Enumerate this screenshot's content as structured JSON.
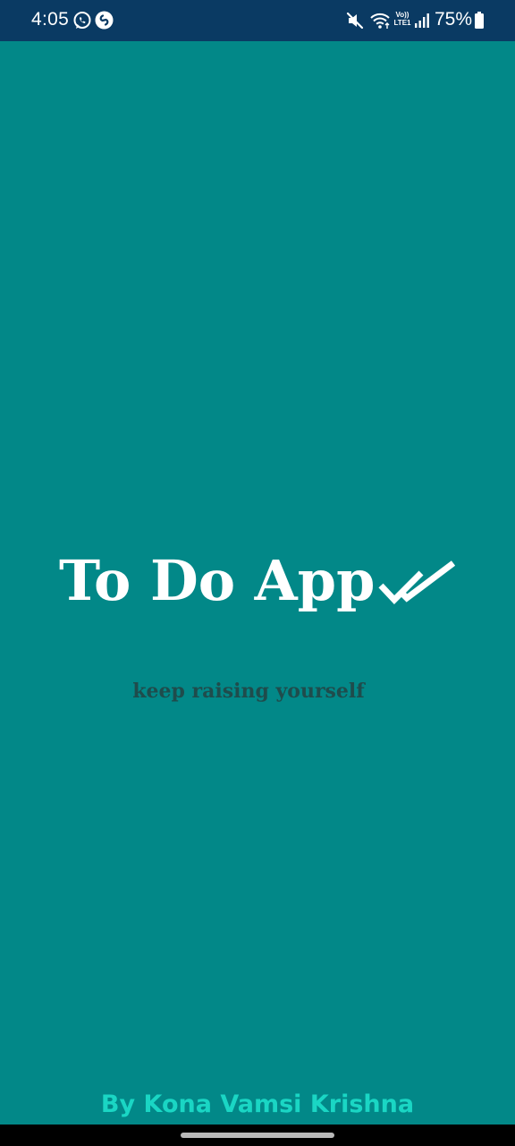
{
  "status_bar": {
    "time": "4:05",
    "battery_percent": "75%",
    "icons": [
      "whatsapp-icon",
      "shazam-icon",
      "mute-icon",
      "wifi-icon",
      "volte-lte-icon",
      "signal-icon",
      "battery-icon"
    ],
    "network_label_top": "Vo))",
    "network_label_bottom": "LTE1"
  },
  "splash": {
    "title": "To Do App",
    "title_icon": "double-check-icon",
    "tagline": "keep raising yourself",
    "author": "By Kona Vamsi Krishna"
  },
  "colors": {
    "background": "#028888",
    "status_bar": "#0a3a63",
    "title": "#ffffff",
    "tagline": "#1f4c4c",
    "author": "#1ad6c4"
  }
}
